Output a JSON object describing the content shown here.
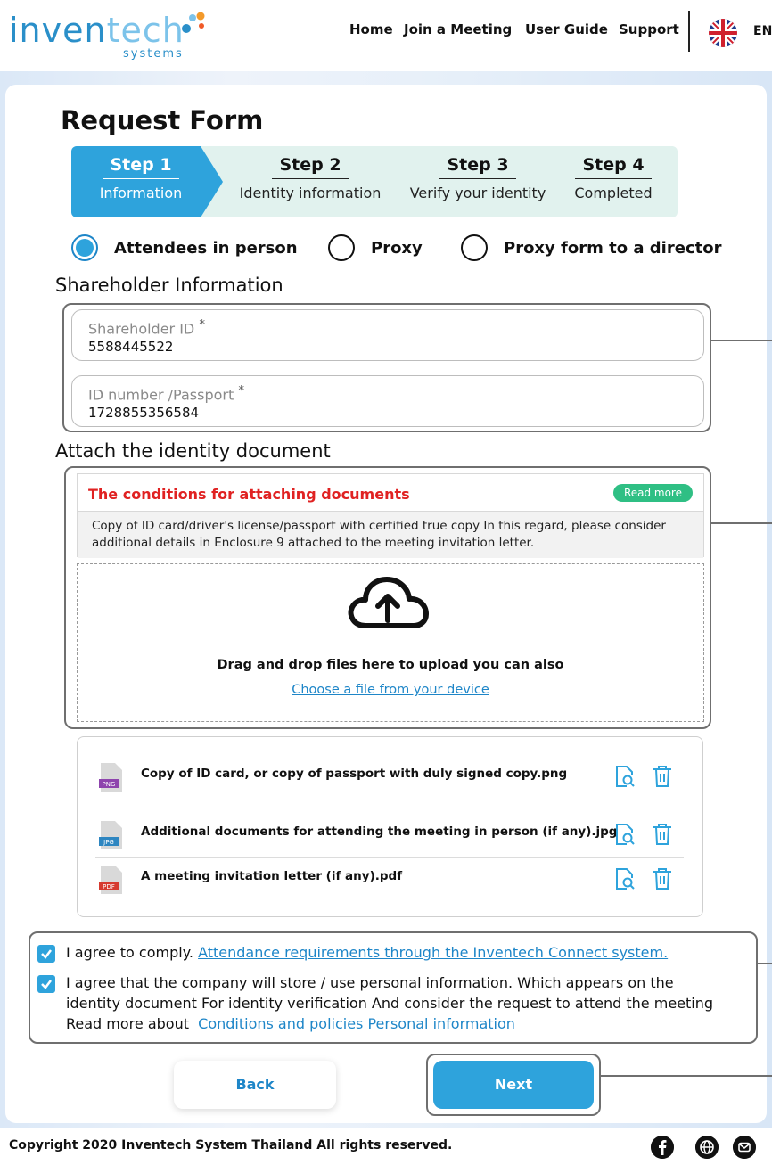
{
  "brand": {
    "logo_main_a": "inven",
    "logo_main_b": "tech",
    "logo_sub": "systems"
  },
  "nav": {
    "items": [
      "Home",
      "Join a Meeting",
      "User Guide",
      "Support"
    ],
    "language": "EN"
  },
  "page": {
    "title": "Request Form"
  },
  "steps": [
    {
      "num": "Step 1",
      "label": "Information",
      "active": true
    },
    {
      "num": "Step 2",
      "label": "Identity information",
      "active": false
    },
    {
      "num": "Step 3",
      "label": "Verify your identity",
      "active": false
    },
    {
      "num": "Step 4",
      "label": "Completed",
      "active": false
    }
  ],
  "attendance": {
    "options": [
      "Attendees in person",
      "Proxy",
      "Proxy form to a director"
    ],
    "selected": "Attendees in person"
  },
  "shareholder": {
    "heading": "Shareholder Information",
    "fields": [
      {
        "label": "Shareholder ID",
        "required_mark": "*",
        "value": "5588445522"
      },
      {
        "label": "ID number /Passport",
        "required_mark": "*",
        "value": "1728855356584"
      }
    ]
  },
  "attach": {
    "heading": "Attach the identity document",
    "conditions_title": "The conditions for attaching documents",
    "read_more": "Read more",
    "conditions_text": "Copy of ID card/driver's license/passport with certified true copy In this regard, please consider additional details in Enclosure 9 attached to the meeting invitation letter.",
    "drop_text": "Drag and drop files here to upload you can also",
    "drop_link": "Choose a file from your device"
  },
  "files": [
    {
      "type": "PNG",
      "name": "Copy of ID card, or copy of passport with duly signed copy.png",
      "color": "#8e44ad"
    },
    {
      "type": "JPG",
      "name": "Additional documents for attending the meeting in person (if any).jpg",
      "color": "#2e86c1"
    },
    {
      "type": "PDF",
      "name": "A meeting invitation letter (if any).pdf",
      "color": "#d63a2f"
    }
  ],
  "agreements": {
    "a1_text": "I agree to comply.",
    "a1_link": "Attendance requirements through the Inventech Connect system.",
    "a2_line1": "I agree that the company will store / use personal information. Which appears on the",
    "a2_line2": "identity document For identity verification And consider the request to attend the meeting",
    "a2_line3": "Read more about",
    "a2_link": "Conditions and policies Personal information"
  },
  "buttons": {
    "back": "Back",
    "next": "Next"
  },
  "footer": {
    "copyright": "Copyright  2020 Inventech System Thailand All rights reserved.",
    "icons": [
      "facebook-icon",
      "globe-icon",
      "email-icon"
    ]
  },
  "colors": {
    "accent": "#2ea3dc",
    "warning": "#e02222",
    "badge": "#2fbf84"
  }
}
